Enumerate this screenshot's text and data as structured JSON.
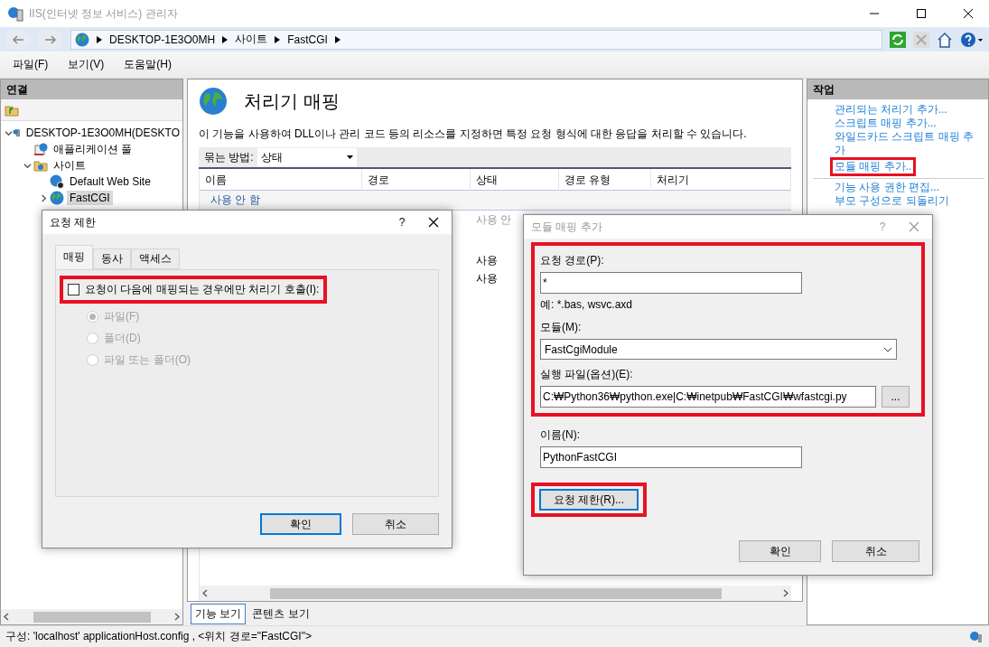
{
  "window": {
    "title": "IIS(인터넷 정보 서비스) 관리자"
  },
  "address_bar": {
    "crumbs": [
      "DESKTOP-1E3O0MH",
      "사이트",
      "FastCGI"
    ]
  },
  "menu": [
    "파일(F)",
    "보기(V)",
    "도움말(H)"
  ],
  "connections": {
    "title": "연결",
    "tree": [
      {
        "label": "DESKTOP-1E3O0MH(DESKTO",
        "expanded": true,
        "selected": false,
        "children": [
          {
            "label": "애플리케이션 풀",
            "selected": false
          },
          {
            "label": "사이트",
            "expanded": true,
            "selected": false,
            "children": [
              {
                "label": "Default Web Site",
                "selected": false
              },
              {
                "label": "FastCGI",
                "expanded": false,
                "selected": true
              }
            ]
          }
        ]
      }
    ]
  },
  "feature": {
    "title": "처리기 매핑",
    "description": "이 기능을 사용하여 DLL이나 관리 코드 등의 리소스를 지정하면 특정 요청 형식에 대한 응답을 처리할 수 있습니다.",
    "group_by": {
      "label": "묶는 방법:",
      "value": "상태"
    },
    "columns": [
      "이름",
      "경로",
      "상태",
      "경로 유형",
      "처리기"
    ],
    "group_label": "사용 안 함",
    "rows": [
      {
        "status": "사용 안",
        "disabled": true
      },
      {
        "status": "사용",
        "disabled": false
      },
      {
        "status": "사용",
        "disabled": false
      }
    ],
    "view_tabs": [
      {
        "label": "기능 보기",
        "selected": true
      },
      {
        "label": "콘텐츠 보기",
        "selected": false
      }
    ]
  },
  "actions": {
    "title": "작업",
    "items": [
      {
        "label": "관리되는 처리기 추가...",
        "highlighted": false
      },
      {
        "label": "스크립트 매핑 추가...",
        "highlighted": false
      },
      {
        "label": "와일드카드 스크립트 매핑 추가",
        "highlighted": false
      },
      {
        "label": "모듈 매핑 추가..",
        "highlighted": true
      },
      {
        "kind": "separator"
      },
      {
        "label": "기능 사용 권한 편집...",
        "highlighted": false
      },
      {
        "label": "부모 구성으로 되돌리기",
        "highlighted": false
      }
    ]
  },
  "status_bar": "구성: 'localhost' applicationHost.config , <위치 경로=\"FastCGI\">",
  "restrictions_dialog": {
    "title": "요청 제한",
    "help": "?",
    "tabs": [
      {
        "label": "매핑",
        "selected": true
      },
      {
        "label": "동사",
        "selected": false
      },
      {
        "label": "액세스",
        "selected": false
      }
    ],
    "checkbox": {
      "label": "요청이 다음에 매핑되는 경우에만 처리기 호출(I):",
      "checked": false,
      "highlighted": true
    },
    "radios": [
      {
        "label": "파일(F)",
        "selected": true,
        "disabled": true
      },
      {
        "label": "폴더(D)",
        "selected": false,
        "disabled": true
      },
      {
        "label": "파일 또는 폴더(O)",
        "selected": false,
        "disabled": true
      }
    ],
    "buttons": [
      {
        "label": "확인",
        "default": true
      },
      {
        "label": "취소",
        "default": false
      }
    ]
  },
  "module_dialog": {
    "title": "모듈 매핑 추가",
    "help": "?",
    "highlighted": true,
    "request_path": {
      "label": "요청 경로(P):",
      "value": "*",
      "hint": "예: *.bas, wsvc.axd"
    },
    "module": {
      "label": "모듈(M):",
      "value": "FastCgiModule"
    },
    "executable": {
      "label": "실행 파일(옵션)(E):",
      "value": "C:₩Python36₩python.exe|C:₩inetpub₩FastCGI₩wfastcgi.py",
      "browse": "..."
    },
    "name": {
      "label": "이름(N):",
      "value": "PythonFastCGI"
    },
    "restrictions_button": {
      "label": "요청 제한(R)...",
      "highlighted": true
    },
    "buttons": [
      {
        "label": "확인",
        "default": false
      },
      {
        "label": "취소",
        "default": false
      }
    ]
  }
}
